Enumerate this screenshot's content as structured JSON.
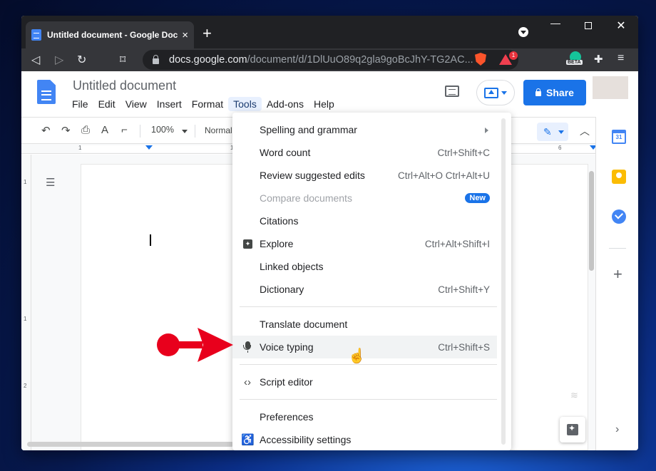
{
  "browser": {
    "tab_title": "Untitled document - Google Docs",
    "tab_close": "×",
    "new_tab": "+",
    "url_host": "docs.google.com",
    "url_path": "/document/d/1DlUuO89q2gla9goBcJhY-TG2AC...",
    "bat_badge": "1",
    "beta_label": "BETA"
  },
  "docs": {
    "title": "Untitled document",
    "menu": [
      "File",
      "Edit",
      "View",
      "Insert",
      "Format",
      "Tools",
      "Add-ons",
      "Help"
    ],
    "share_label": "Share",
    "zoom": "100%",
    "style": "Normal"
  },
  "ruler": {
    "numbers": [
      "1",
      "1",
      "6"
    ]
  },
  "vruler": {
    "numbers": [
      "1",
      "1",
      "2"
    ]
  },
  "side_panel": {
    "calendar_day": "31"
  },
  "tools_menu": {
    "items": [
      {
        "label": "Spelling and grammar",
        "shortcut": ""
      },
      {
        "label": "Word count",
        "shortcut": "Ctrl+Shift+C"
      },
      {
        "label": "Review suggested edits",
        "shortcut": "Ctrl+Alt+O Ctrl+Alt+U"
      },
      {
        "label": "Compare documents",
        "badge": "New"
      },
      {
        "label": "Citations",
        "shortcut": ""
      },
      {
        "label": "Explore",
        "shortcut": "Ctrl+Alt+Shift+I"
      },
      {
        "label": "Linked objects",
        "shortcut": ""
      },
      {
        "label": "Dictionary",
        "shortcut": "Ctrl+Shift+Y"
      },
      {
        "label": "Translate document",
        "shortcut": ""
      },
      {
        "label": "Voice typing",
        "shortcut": "Ctrl+Shift+S"
      },
      {
        "label": "Script editor",
        "shortcut": ""
      },
      {
        "label": "Preferences",
        "shortcut": ""
      },
      {
        "label": "Accessibility settings",
        "shortcut": ""
      }
    ]
  },
  "colors": {
    "accent": "#1a73e8",
    "annotation_arrow": "#e8001c"
  }
}
